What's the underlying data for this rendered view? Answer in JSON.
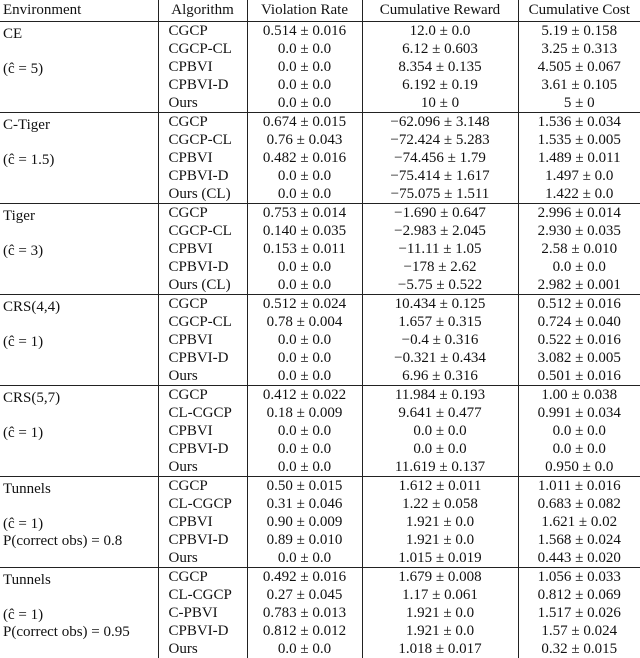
{
  "headers": [
    "Environment",
    "Algorithm",
    "Violation Rate",
    "Cumulative Reward",
    "Cumulative Cost"
  ],
  "groups": [
    {
      "env": "CE",
      "param": "(ĉ = 5)",
      "extra": "",
      "rows": [
        {
          "alg": "CGCP",
          "vr": "0.514 ± 0.016",
          "cr": "12.0 ± 0.0",
          "cc": "5.19 ± 0.158"
        },
        {
          "alg": "CGCP-CL",
          "vr": "0.0 ± 0.0",
          "cr": "6.12 ± 0.603",
          "cc": "3.25 ± 0.313"
        },
        {
          "alg": "CPBVI",
          "vr": "0.0 ± 0.0",
          "cr": "8.354 ± 0.135",
          "cc": "4.505 ± 0.067"
        },
        {
          "alg": "CPBVI-D",
          "vr": "0.0 ± 0.0",
          "cr": "6.192 ± 0.19",
          "cc": "3.61 ± 0.105"
        },
        {
          "alg": "Ours",
          "vr": "0.0 ± 0.0",
          "cr": "10 ± 0",
          "cc": "5 ± 0"
        }
      ]
    },
    {
      "env": "C-Tiger",
      "param": "(ĉ = 1.5)",
      "extra": "",
      "rows": [
        {
          "alg": "CGCP",
          "vr": "0.674 ± 0.015",
          "cr": "−62.096 ± 3.148",
          "cc": "1.536 ± 0.034"
        },
        {
          "alg": "CGCP-CL",
          "vr": "0.76 ± 0.043",
          "cr": "−72.424 ± 5.283",
          "cc": "1.535 ± 0.005"
        },
        {
          "alg": "CPBVI",
          "vr": "0.482 ± 0.016",
          "cr": "−74.456 ± 1.79",
          "cc": "1.489 ± 0.011"
        },
        {
          "alg": "CPBVI-D",
          "vr": "0.0 ± 0.0",
          "cr": "−75.414 ± 1.617",
          "cc": "1.497 ± 0.0"
        },
        {
          "alg": "Ours (CL)",
          "vr": "0.0 ± 0.0",
          "cr": "−75.075 ± 1.511",
          "cc": "1.422 ± 0.0"
        }
      ]
    },
    {
      "env": "Tiger",
      "param": "(ĉ = 3)",
      "extra": "",
      "rows": [
        {
          "alg": "CGCP",
          "vr": "0.753 ± 0.014",
          "cr": "−1.690 ± 0.647",
          "cc": "2.996 ± 0.014"
        },
        {
          "alg": "CGCP-CL",
          "vr": "0.140 ± 0.035",
          "cr": "−2.983 ± 2.045",
          "cc": "2.930 ± 0.035"
        },
        {
          "alg": "CPBVI",
          "vr": "0.153 ± 0.011",
          "cr": "−11.11 ± 1.05",
          "cc": "2.58 ± 0.010"
        },
        {
          "alg": "CPBVI-D",
          "vr": "0.0 ± 0.0",
          "cr": "−178 ± 2.62",
          "cc": "0.0 ± 0.0"
        },
        {
          "alg": "Ours (CL)",
          "vr": "0.0 ± 0.0",
          "cr": "−5.75 ± 0.522",
          "cc": "2.982 ± 0.001"
        }
      ]
    },
    {
      "env": "CRS(4,4)",
      "param": "(ĉ = 1)",
      "extra": "",
      "rows": [
        {
          "alg": "CGCP",
          "vr": "0.512 ± 0.024",
          "cr": "10.434 ± 0.125",
          "cc": "0.512 ± 0.016"
        },
        {
          "alg": "CGCP-CL",
          "vr": "0.78 ± 0.004",
          "cr": "1.657 ± 0.315",
          "cc": "0.724 ± 0.040"
        },
        {
          "alg": "CPBVI",
          "vr": "0.0 ± 0.0",
          "cr": "−0.4 ± 0.316",
          "cc": "0.522 ± 0.016"
        },
        {
          "alg": "CPBVI-D",
          "vr": "0.0 ± 0.0",
          "cr": "−0.321 ± 0.434",
          "cc": "3.082 ± 0.005"
        },
        {
          "alg": "Ours",
          "vr": "0.0 ± 0.0",
          "cr": "6.96 ± 0.316",
          "cc": "0.501 ± 0.016"
        }
      ]
    },
    {
      "env": "CRS(5,7)",
      "param": "(ĉ = 1)",
      "extra": "",
      "rows": [
        {
          "alg": "CGCP",
          "vr": "0.412 ± 0.022",
          "cr": "11.984 ± 0.193",
          "cc": "1.00 ± 0.038"
        },
        {
          "alg": "CL-CGCP",
          "vr": "0.18 ± 0.009",
          "cr": "9.641 ± 0.477",
          "cc": "0.991 ± 0.034"
        },
        {
          "alg": "CPBVI",
          "vr": "0.0 ± 0.0",
          "cr": "0.0 ± 0.0",
          "cc": "0.0 ± 0.0"
        },
        {
          "alg": "CPBVI-D",
          "vr": "0.0 ± 0.0",
          "cr": "0.0 ± 0.0",
          "cc": "0.0 ± 0.0"
        },
        {
          "alg": "Ours",
          "vr": "0.0 ± 0.0",
          "cr": "11.619 ± 0.137",
          "cc": "0.950 ± 0.0"
        }
      ]
    },
    {
      "env": "Tunnels",
      "param": "(ĉ = 1)",
      "extra": "P(correct obs) = 0.8",
      "rows": [
        {
          "alg": "CGCP",
          "vr": "0.50 ± 0.015",
          "cr": "1.612 ± 0.011",
          "cc": "1.011 ± 0.016"
        },
        {
          "alg": "CL-CGCP",
          "vr": "0.31 ± 0.046",
          "cr": "1.22 ± 0.058",
          "cc": "0.683 ± 0.082"
        },
        {
          "alg": "CPBVI",
          "vr": "0.90 ± 0.009",
          "cr": "1.921 ± 0.0",
          "cc": "1.621 ± 0.02"
        },
        {
          "alg": "CPBVI-D",
          "vr": "0.89 ± 0.010",
          "cr": "1.921 ± 0.0",
          "cc": "1.568 ± 0.024"
        },
        {
          "alg": "Ours",
          "vr": "0.0 ± 0.0",
          "cr": "1.015 ± 0.019",
          "cc": "0.443 ± 0.020"
        }
      ]
    },
    {
      "env": "Tunnels",
      "param": "(ĉ = 1)",
      "extra": "P(correct obs) = 0.95",
      "rows": [
        {
          "alg": "CGCP",
          "vr": "0.492 ± 0.016",
          "cr": "1.679 ± 0.008",
          "cc": "1.056 ± 0.033"
        },
        {
          "alg": "CL-CGCP",
          "vr": "0.27 ± 0.045",
          "cr": "1.17 ± 0.061",
          "cc": "0.812 ± 0.069"
        },
        {
          "alg": "C-PBVI",
          "vr": "0.783 ± 0.013",
          "cr": "1.921 ± 0.0",
          "cc": "1.517 ± 0.026"
        },
        {
          "alg": "CPBVI-D",
          "vr": "0.812 ± 0.012",
          "cr": "1.921 ± 0.0",
          "cc": "1.57 ± 0.024"
        },
        {
          "alg": "Ours",
          "vr": "0.0 ± 0.0",
          "cr": "1.018 ± 0.017",
          "cc": "0.32 ± 0.015"
        }
      ]
    }
  ]
}
